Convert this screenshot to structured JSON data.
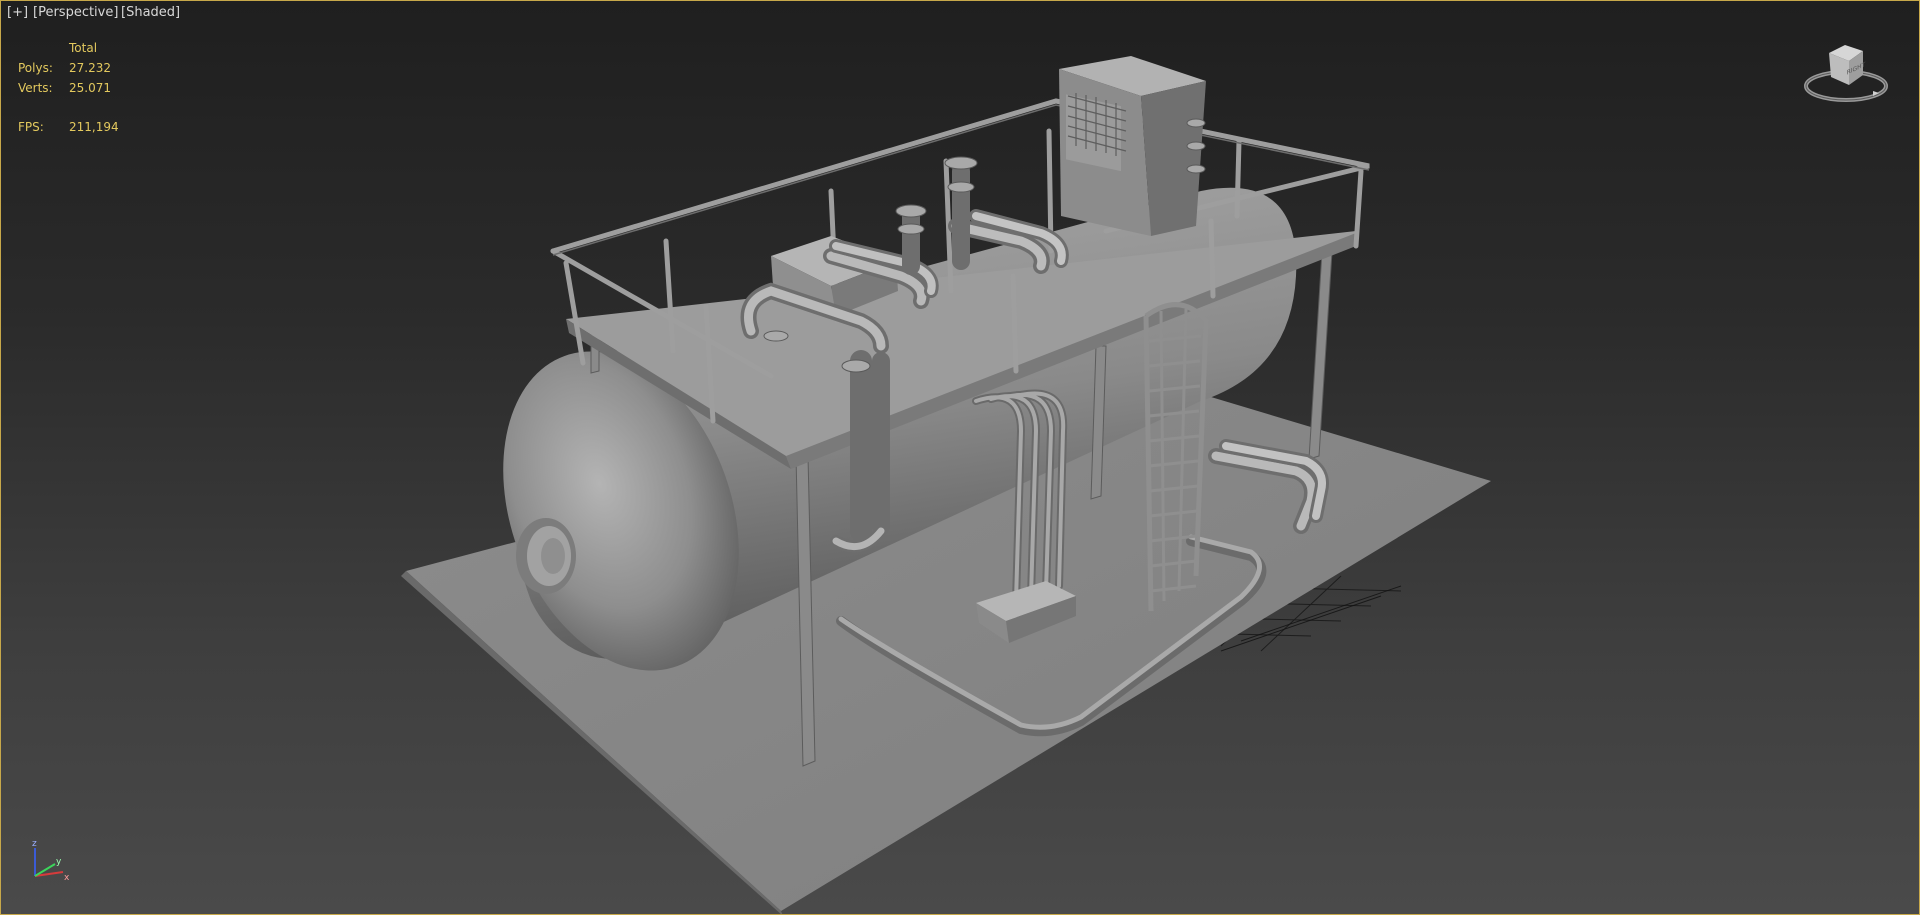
{
  "viewport": {
    "labels": {
      "plus": "[+]",
      "view": "[Perspective]",
      "shading": "[Shaded]"
    },
    "accent_color": "#c7a84a"
  },
  "stats": {
    "header": "Total",
    "polys_label": "Polys:",
    "polys_value": "27.232",
    "verts_label": "Verts:",
    "verts_value": "25.071",
    "fps_label": "FPS:",
    "fps_value": "211,194",
    "text_color": "#e3c95e"
  },
  "viewcube": {
    "face_label": "RIGHT",
    "icon": "viewcube-icon"
  },
  "axis_tripod": {
    "x": "x",
    "y": "y",
    "z": "z"
  }
}
